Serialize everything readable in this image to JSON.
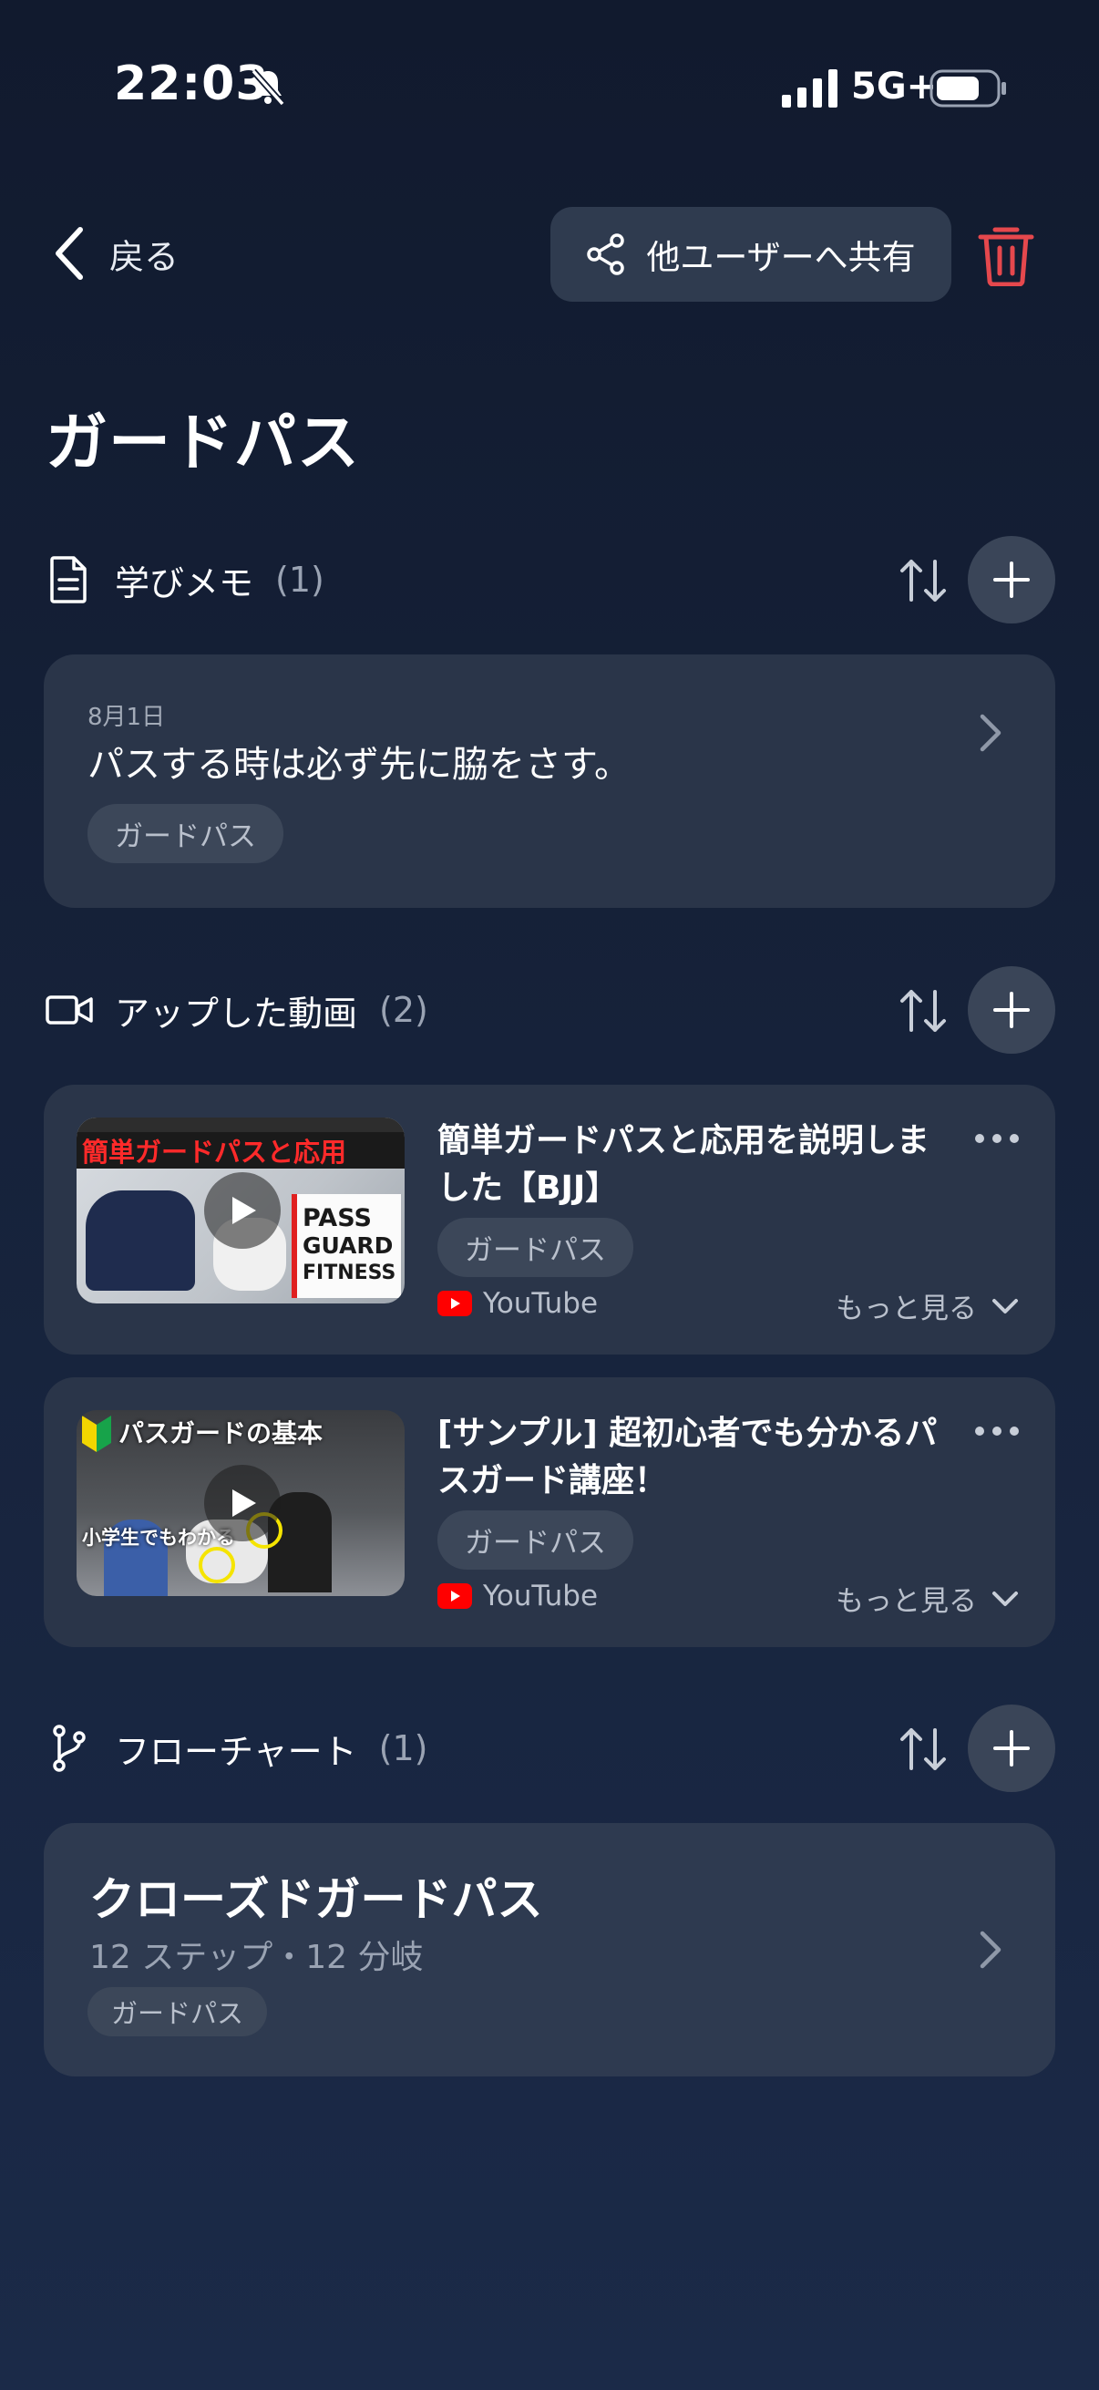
{
  "status_bar": {
    "time": "22:03",
    "network": "5G+"
  },
  "header": {
    "back_label": "戻る",
    "share_label": "他ユーザーへ共有"
  },
  "page_title": "ガードパス",
  "memo_section": {
    "title": "学びメモ",
    "count": "(1)",
    "items": [
      {
        "date": "8月1日",
        "text": "パスする時は必ず先に脇をさす。",
        "tag": "ガードパス"
      }
    ]
  },
  "video_section": {
    "title": "アップした動画",
    "count": "(2)",
    "items": [
      {
        "title": "簡単ガードパスと応用を説明しました【BJJ】",
        "tag": "ガードパス",
        "source": "YouTube",
        "more_label": "もっと見る",
        "thumb_caption": "簡単ガードパスと応用",
        "thumb_side": [
          "PASS",
          "GUARD",
          "FITNESS"
        ]
      },
      {
        "title": "[サンプル] 超初心者でも分かるパスガード講座！",
        "tag": "ガードパス",
        "source": "YouTube",
        "more_label": "もっと見る",
        "thumb_caption": "パスガードの基本",
        "thumb_sub": "小学生でもわかる"
      }
    ]
  },
  "flow_section": {
    "title": "フローチャート",
    "count": "(1)",
    "items": [
      {
        "title": "クローズドガードパス",
        "subtitle": "12 ステップ・12 分岐",
        "tag": "ガードパス"
      }
    ]
  },
  "colors": {
    "accent_red": "#e5484d",
    "youtube_red": "#ff0000",
    "card_bg": "#2a3549"
  }
}
